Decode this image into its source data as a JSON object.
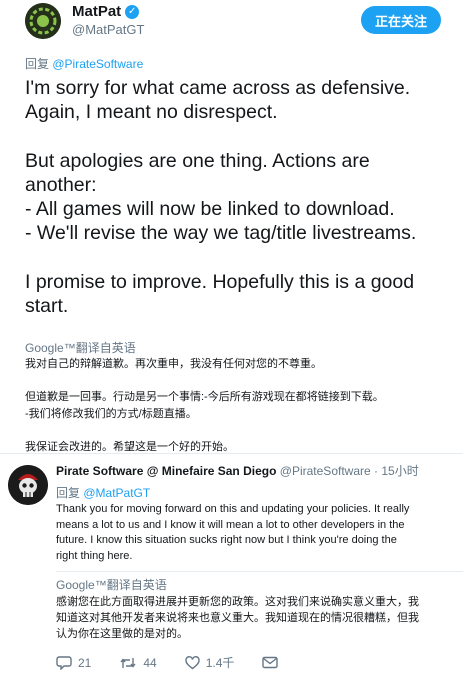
{
  "tweet": {
    "author_name": "MatPat",
    "author_handle": "@MatPatGT",
    "follow_label": "正在关注",
    "reply_prefix": "回复",
    "reply_handle": "@PirateSoftware",
    "text": "I'm sorry for what came across as defensive.\nAgain, I meant no disrespect.\n\nBut apologies are one thing. Actions are\nanother:\n- All games will now be linked to download.\n- We'll revise the way we tag/title livestreams.\n\nI promise to improve. Hopefully this is a good\nstart.",
    "translate_label": "Google™翻译自英语",
    "translation": "我对自己的辩解道歉。再次重申，我没有任何对您的不尊重。\n\n但道歉是一回事。行动是另一个事情:-今后所有游戏现在都将链接到下载。\n-我们将修改我们的方式/标题直播。\n\n我保证会改进的。希望这是一个好的开始。"
  },
  "reply": {
    "author_name": "Pirate Software @ Minefaire San Diego",
    "author_handle": "@PirateSoftware",
    "time": "· 15小时",
    "reply_prefix": "回复",
    "reply_handle": "@MatPatGT",
    "text": "Thank you for moving forward on this and updating your policies. It really\nmeans a lot to us and I know it will mean a lot to other developers in the\nfuture. I know this situation sucks right now but I think you're doing the\nright thing here.",
    "translate_label": "Google™翻译自英语",
    "translation": "感谢您在此方面取得进展并更新您的政策。这对我们来说确实意义重大，我\n知道这对其他开发者来说将来也意义重大。我知道现在的情况很糟糕，但我\n认为你在这里做的是对的。",
    "reply_count": "21",
    "retweet_count": "44",
    "like_count": "1.4千"
  },
  "icons": {
    "verified": "verified-badge-icon",
    "reply": "reply-icon",
    "retweet": "retweet-icon",
    "like": "heart-icon",
    "message": "direct-message-icon"
  },
  "colors": {
    "accent": "#1da1f2",
    "secondary_text": "#657786",
    "primary_text": "#14171a",
    "divider": "#e6ecf0"
  }
}
